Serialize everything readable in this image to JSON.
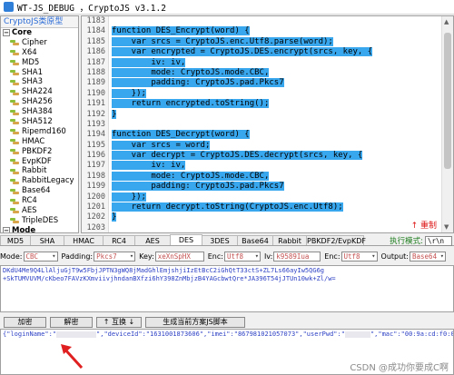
{
  "window": {
    "title": "WT-JS_DEBUG ，CryptoJS v3.1.2"
  },
  "tree": {
    "header": "CryptoJS类原型",
    "groups": [
      {
        "label": "Core",
        "items": [
          "Cipher",
          "X64",
          "MD5",
          "SHA1",
          "SHA3",
          "SHA224",
          "SHA256",
          "SHA384",
          "SHA512",
          "Ripemd160",
          "HMAC",
          "PBKDF2",
          "EvpKDF",
          "Rabbit",
          "RabbitLegacy",
          "Base64",
          "RC4",
          "AES",
          "TripleDES"
        ]
      },
      {
        "label": "Mode",
        "items": []
      }
    ]
  },
  "editor": {
    "line_numbers": [
      "1183",
      "1184",
      "1185",
      "1186",
      "1187",
      "1188",
      "1189",
      "1190",
      "1191",
      "1192",
      "1193",
      "1194",
      "1195",
      "1196",
      "1197",
      "1198",
      "1199",
      "1200",
      "1201",
      "1202",
      "1203"
    ],
    "lines": [
      "",
      "function DES_Encrypt(word) {",
      "    var srcs = CryptoJS.enc.Utf8.parse(word);",
      "    var encrypted = CryptoJS.DES.encrypt(srcs, key, {",
      "        iv: iv,",
      "        mode: CryptoJS.mode.CBC,",
      "        padding: CryptoJS.pad.Pkcs7",
      "    });",
      "    return encrypted.toString();",
      "}",
      "",
      "function DES_Decrypt(word) {",
      "    var srcs = word;",
      "    var decrypt = CryptoJS.DES.decrypt(srcs, key, {",
      "        iv: iv,",
      "        mode: CryptoJS.mode.CBC,",
      "        padding: CryptoJS.pad.Pkcs7",
      "    });",
      "    return decrypt.toString(CryptoJS.enc.Utf8);",
      "}",
      ""
    ],
    "fold_label": "↑ 重制"
  },
  "algo_tabs": [
    "MD5",
    "SHA",
    "HMAC",
    "RC4",
    "AES",
    "DES",
    "3DES",
    "Base64",
    "Rabbit",
    "PBKDF2/EvpKDF"
  ],
  "active_tab": "DES",
  "exec_mode": {
    "label": "执行模式:",
    "value": "\\r\\n"
  },
  "options": {
    "mode": {
      "label": "Mode:",
      "value": "CBC"
    },
    "padding": {
      "label": "Padding:",
      "value": "Pkcs7"
    },
    "key": {
      "label": "Key:",
      "value": "xeXnSpHX"
    },
    "key_enc": {
      "label": "Enc:",
      "value": "Utf8"
    },
    "iv": {
      "label": "Iv:",
      "value": "k9589Iua"
    },
    "iv_enc": {
      "label": "Enc:",
      "value": "Utf8"
    },
    "output": {
      "label": "Output:",
      "value": "Base64"
    }
  },
  "input_text": "DKdU4Me9Q4LlAljuGjT9w5FbjJPTN3gWQ8jMadGhlEmjshjiIzEtBcC2iGhQtT33ctS+ZL7Ls66ayIw5QG6g\n+SkTUMVUVM/cKbeo7FAVzKXmviivjhndanBXfzi6hY398ZnMbjzB4YAGcbwtQre*JA396T54jJTUn10wk+Zl/w=",
  "buttons": {
    "encrypt": "加密",
    "decrypt": "解密",
    "swap": "↑ 互换 ↓",
    "gen": "生成当前方案JS脚本"
  },
  "result": {
    "p1": "{\"loginName\":\"",
    "p2": "\",\"deviceId\":\"1631001873606\",\"imei\":\"867981021057073\",\"userPwd\":\"",
    "p3": "\",\"mac\":\"00:9a:cd:f0:0d:c5\"}"
  },
  "watermark": "CSDN @成功你要成C啊"
}
